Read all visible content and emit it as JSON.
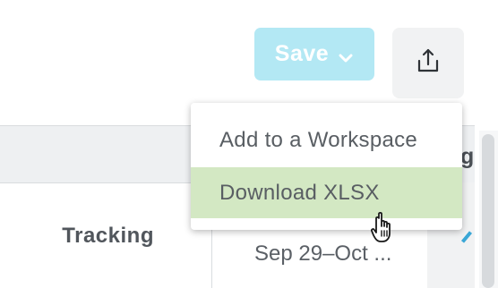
{
  "toolbar": {
    "save_label": "Save",
    "save_color": "#b3e8f4",
    "share_icon": "share-upload-icon"
  },
  "table": {
    "header_partial": "g",
    "row": {
      "label": "Tracking",
      "date_range": "Sep 29–Oct ..."
    }
  },
  "dropdown": {
    "items": [
      {
        "label": "Add to a Workspace",
        "hovered": false
      },
      {
        "label": "Download XLSX",
        "hovered": true,
        "hover_color": "#d3e8c3"
      }
    ]
  }
}
